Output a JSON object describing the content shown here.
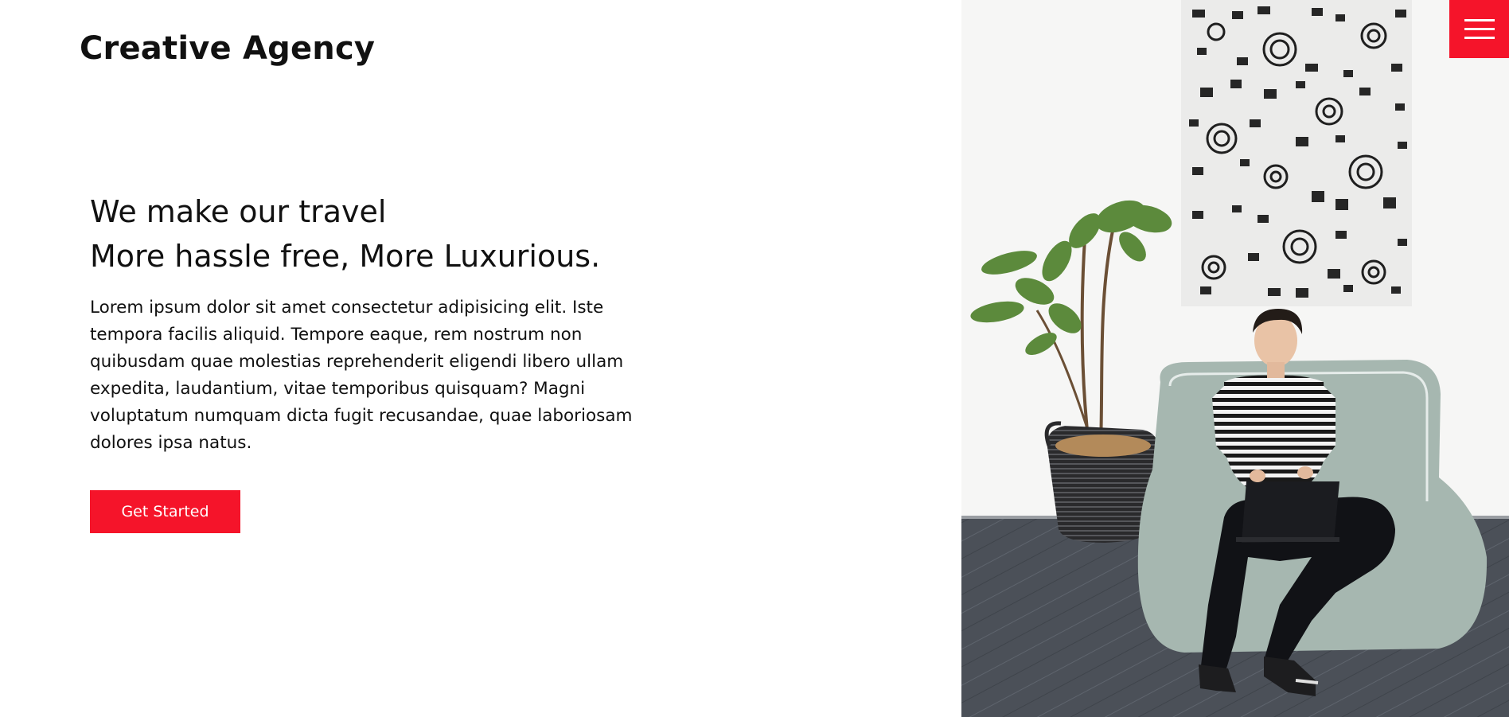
{
  "brand": {
    "name": "Creative Agency",
    "accent_color": "#f5142a"
  },
  "hero": {
    "headline_line1": "We make our travel",
    "headline_line2": "More hassle free, More Luxurious.",
    "description": "Lorem ipsum dolor sit amet consectetur adipisicing elit. Iste tempora facilis aliquid. Tempore eaque, rem nostrum non quibusdam quae molestias reprehenderit eligendi libero ullam expedita, laudantium, vitae temporibus quisquam? Magni voluptatum numquam dicta fugit recusandae, quae laboriosam dolores ipsa natus.",
    "cta_label": "Get Started"
  },
  "header": {
    "menu_icon": "hamburger-menu-icon"
  },
  "image": {
    "subject": "hero-photo"
  }
}
